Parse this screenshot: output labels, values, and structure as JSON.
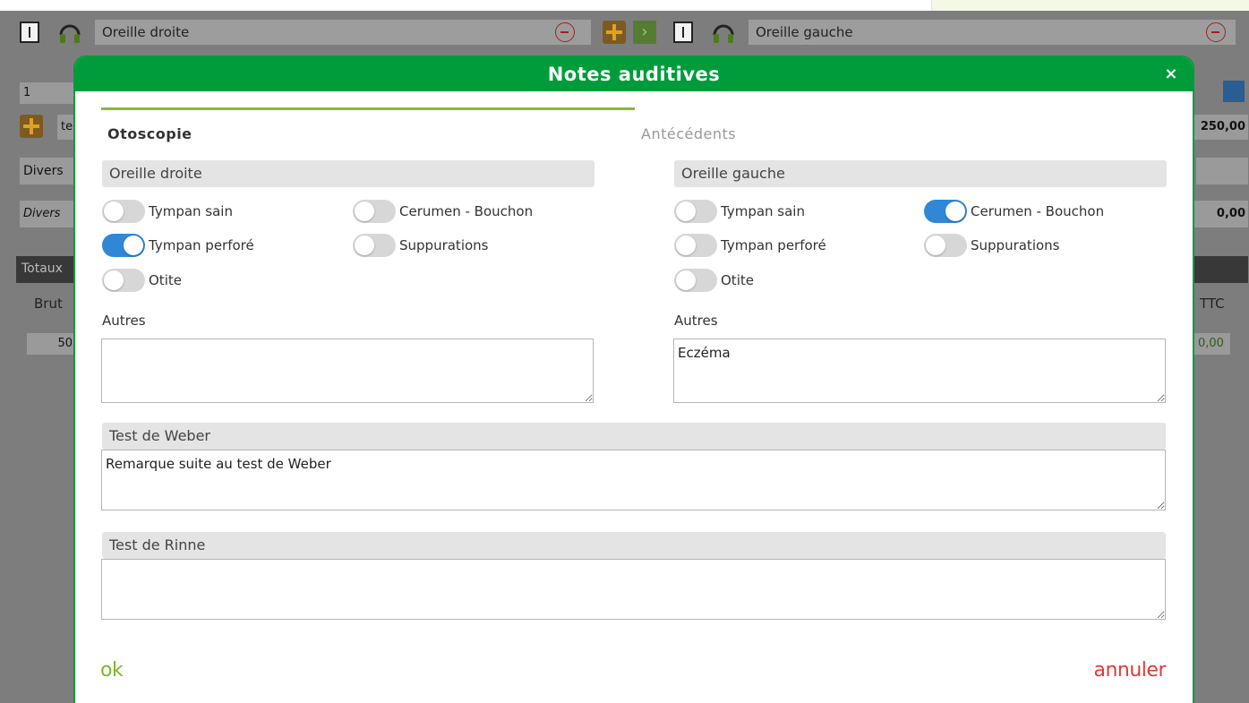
{
  "background": {
    "left_field": "Oreille droite",
    "right_field": "Oreille gauche",
    "row_value": "1",
    "text_short": "te",
    "amount_1": "250,00",
    "divers_label": "Divers",
    "divers_input": "Divers",
    "amount_2": "0,00",
    "totals_label": "Totaux",
    "brut_label": "Brut",
    "ttc_label": "TTC",
    "value_left": "50",
    "value_right": "0,00"
  },
  "modal": {
    "title": "Notes auditives",
    "close_label": "×",
    "tabs": [
      {
        "label": "Otoscopie",
        "active": true
      },
      {
        "label": "Antécédents",
        "active": false
      }
    ],
    "right_ear": {
      "title": "Oreille droite",
      "toggles": [
        {
          "label": "Tympan sain",
          "on": false
        },
        {
          "label": "Cerumen - Bouchon",
          "on": false
        },
        {
          "label": "Tympan perforé",
          "on": true
        },
        {
          "label": "Suppurations",
          "on": false
        },
        {
          "label": "Otite",
          "on": false
        }
      ],
      "other_label": "Autres",
      "other_value": ""
    },
    "left_ear": {
      "title": "Oreille gauche",
      "toggles": [
        {
          "label": "Tympan sain",
          "on": false
        },
        {
          "label": "Cerumen - Bouchon",
          "on": true
        },
        {
          "label": "Tympan perforé",
          "on": false
        },
        {
          "label": "Suppurations",
          "on": false
        },
        {
          "label": "Otite",
          "on": false
        }
      ],
      "other_label": "Autres",
      "other_value": "Eczéma"
    },
    "weber": {
      "title": "Test de Weber",
      "value": "Remarque suite au test de Weber"
    },
    "rinne": {
      "title": "Test de Rinne",
      "value": ""
    },
    "ok_label": "ok",
    "cancel_label": "annuler"
  },
  "colors": {
    "header_green": "#009c3b",
    "tab_underline": "#88b83a",
    "toggle_on": "#2f87d6",
    "ok_green": "#7ab82c",
    "cancel_red": "#e33a3a"
  }
}
